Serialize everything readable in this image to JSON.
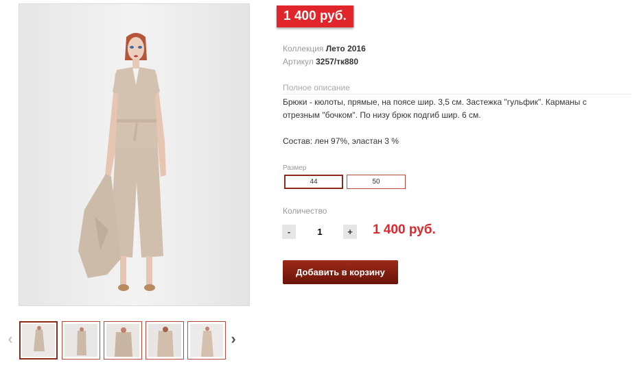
{
  "price_badge": "1 400 руб.",
  "meta": {
    "collection_label": "Коллекция",
    "collection_value": "Лето 2016",
    "article_label": "Артикул",
    "article_value": "3257/тк880"
  },
  "description": {
    "title": "Полное описание",
    "text": "Брюки - кюлоты, прямые, на поясе шир. 3,5 см. Застежка \"гульфик\". Карманы с отрезным \"бочком\". По низу брюк подгиб шир. 6 см.",
    "composition": "Состав: лен 97%, эластан 3 %"
  },
  "size": {
    "label": "Размер",
    "options": [
      "44",
      "50"
    ],
    "selected": "44"
  },
  "quantity": {
    "label": "Количество",
    "minus": "-",
    "plus": "+",
    "value": "1"
  },
  "total_price": "1 400 руб.",
  "add_to_cart_label": "Добавить в корзину",
  "gallery": {
    "prev_icon": "chevron-left-icon",
    "next_icon": "chevron-right-icon",
    "prev_glyph": "‹",
    "next_glyph": "›",
    "thumbnail_count": 5,
    "active_index": 0
  },
  "colors": {
    "accent_red": "#e0262b",
    "button_dark_red": "#8e2a1b",
    "border_red": "#b44b38",
    "outfit_beige": "#d4c2b1"
  }
}
